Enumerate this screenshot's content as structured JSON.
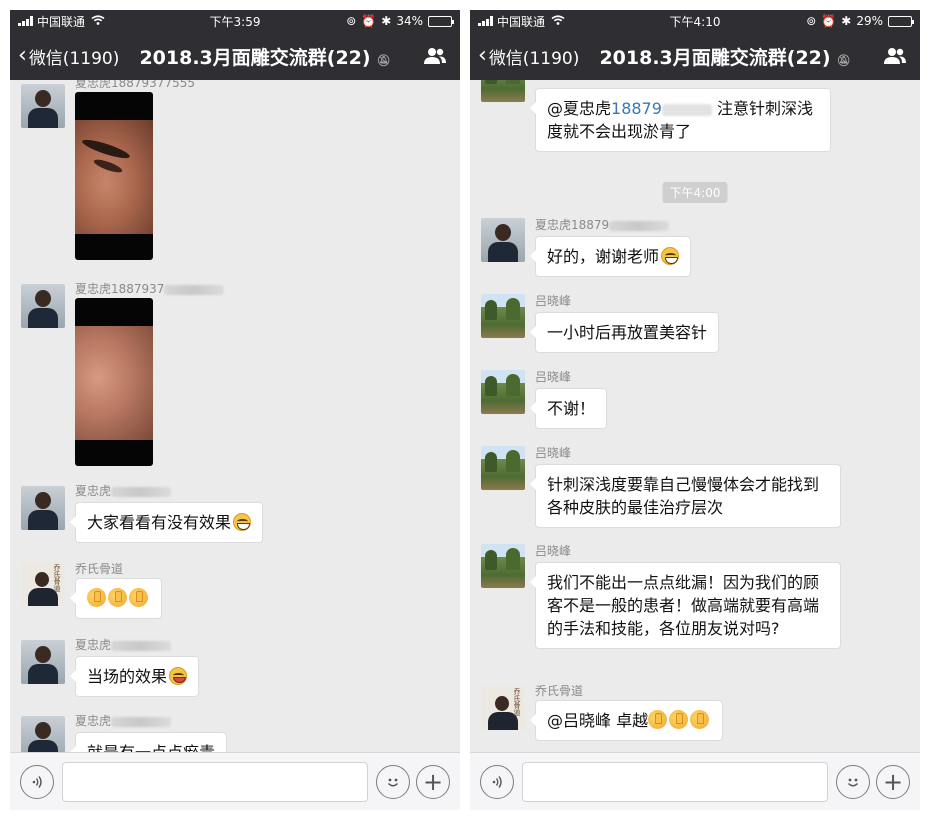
{
  "left": {
    "status": {
      "carrier": "中国联通",
      "time": "下午3:59",
      "battery": "34%",
      "battery_fraction": 0.34
    },
    "nav": {
      "back_label": "微信(1190)",
      "title": "2018.3月面雕交流群(22)"
    },
    "messages": [
      {
        "sender": "夏忠虎18879377555",
        "type": "image"
      },
      {
        "sender": "夏忠虎1887937",
        "type": "image"
      },
      {
        "sender": "夏忠虎",
        "text": "大家看看有没有效果"
      },
      {
        "sender": "乔氏骨道",
        "text": ""
      },
      {
        "sender": "夏忠虎",
        "text": "当场的效果"
      },
      {
        "sender": "夏忠虎",
        "text": "就是有一点点瘀青"
      }
    ]
  },
  "right": {
    "status": {
      "carrier": "中国联通",
      "time": "下午4:10",
      "battery": "29%",
      "battery_fraction": 0.29
    },
    "nav": {
      "back_label": "微信(1190)",
      "title": "2018.3月面雕交流群(22)"
    },
    "first_bubble": {
      "mention": "@夏忠虎",
      "phone": "18879",
      "rest": "注意针刺深浅度就不会出现淤青了"
    },
    "timestamp": "下午4:00",
    "messages": [
      {
        "sender": "夏忠虎18879",
        "text": "好的，谢谢老师"
      },
      {
        "sender": "吕晓峰",
        "text": "一小时后再放置美容针"
      },
      {
        "sender": "吕晓峰",
        "text": "不谢！"
      },
      {
        "sender": "吕晓峰",
        "text": "针刺深浅度要靠自己慢慢体会才能找到各种皮肤的最佳治疗层次"
      },
      {
        "sender": "吕晓峰",
        "text": "我们不能出一点点纰漏！因为我们的顾客不是一般的患者！做高端就要有高端的手法和技能，各位朋友说对吗?"
      },
      {
        "sender": "乔氏骨道",
        "text": "@吕晓峰 卓越"
      }
    ]
  },
  "avatar_text": "乔氏骨道",
  "icons": {
    "voice": "voice-icon",
    "emoji": "emoji-icon",
    "plus": "plus-icon",
    "people": "group-members-icon",
    "mute": "mute-icon"
  }
}
